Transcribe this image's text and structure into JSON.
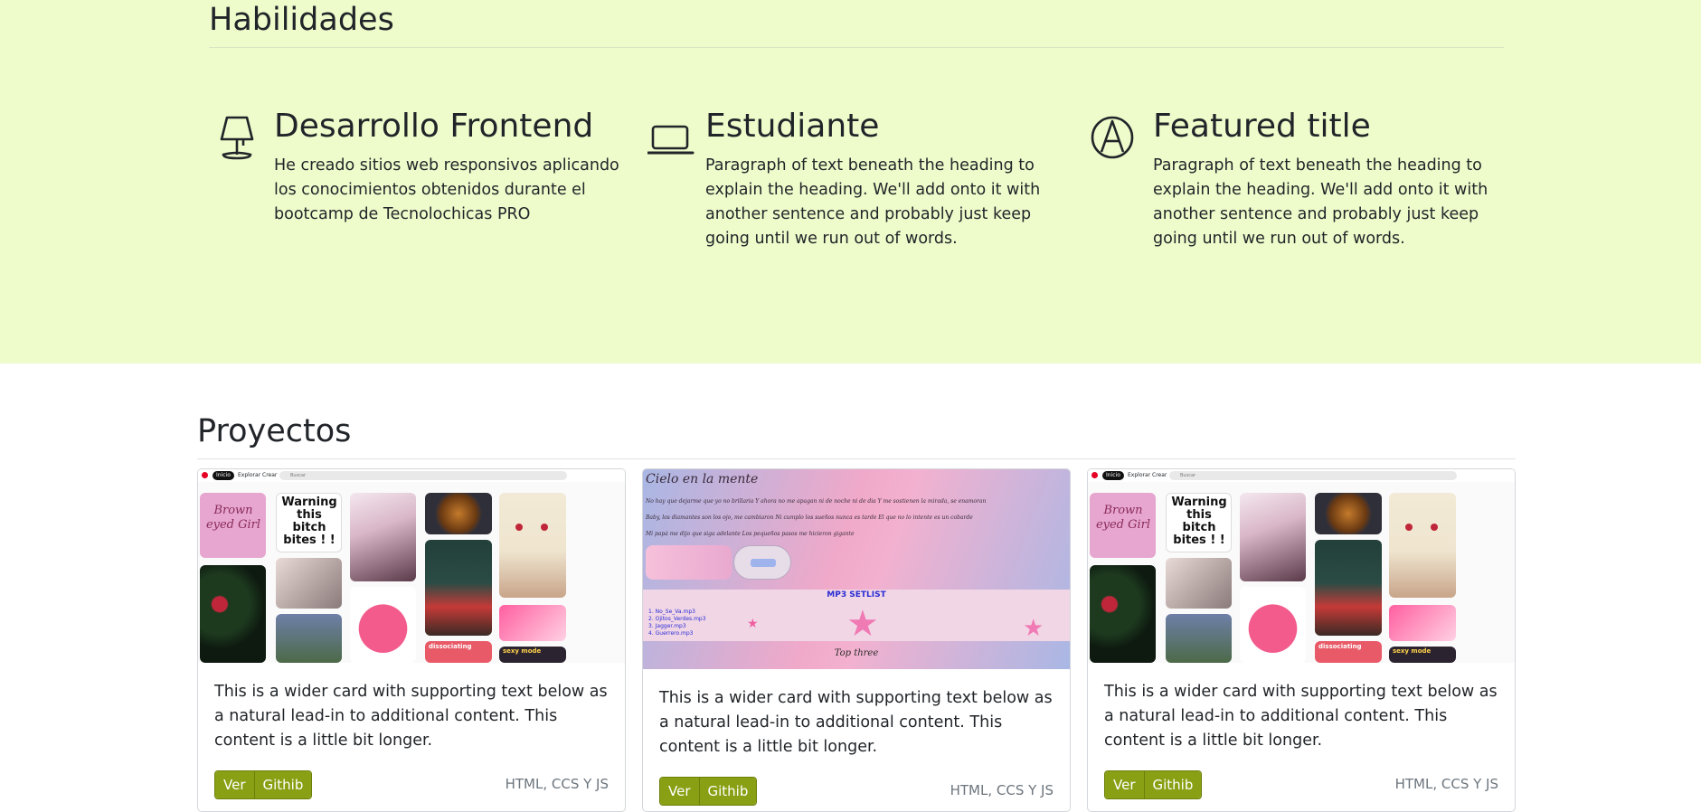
{
  "skills": {
    "title": "Habilidades",
    "features": [
      {
        "icon": "lamp-icon",
        "title": "Desarrollo Frontend",
        "text": "He creado sitios web responsivos aplicando los conocimientos obtenidos durante el bootcamp de Tecnolochicas PRO"
      },
      {
        "icon": "laptop-icon",
        "title": "Estudiante",
        "text": "Paragraph of text beneath the heading to explain the heading. We'll add onto it with another sentence and probably just keep going until we run out of words."
      },
      {
        "icon": "pen-circle-icon",
        "title": "Featured title",
        "text": "Paragraph of text beneath the heading to explain the heading. We'll add onto it with another sentence and probably just keep going until we run out of words."
      }
    ]
  },
  "projects": {
    "title": "Proyectos",
    "cards": [
      {
        "thumb": "pinterest",
        "text": "This is a wider card with supporting text below as a natural lead-in to additional content. This content is a little bit longer.",
        "btn_view": "Ver",
        "btn_github": "Githib",
        "tech": "HTML, CCS Y JS"
      },
      {
        "thumb": "cielo",
        "text": "This is a wider card with supporting text below as a natural lead-in to additional content. This content is a little bit longer.",
        "btn_view": "Ver",
        "btn_github": "Githib",
        "tech": "HTML, CCS Y JS"
      },
      {
        "thumb": "pinterest",
        "text": "This is a wider card with supporting text below as a natural lead-in to additional content. This content is a little bit longer.",
        "btn_view": "Ver",
        "btn_github": "Githib",
        "tech": "HTML, CCS Y JS"
      }
    ]
  },
  "thumb_pinterest": {
    "nav": [
      "Inicio",
      "Explorar",
      "Crear"
    ],
    "search": "Buscar",
    "tile_brown": "Brown eyed Girl",
    "tile_warning": "Warning this bitch bites ! !",
    "tile_dissociating": "dissociating",
    "tile_sexy": "sexy mode"
  },
  "thumb_cielo": {
    "title": "Cielo en la mente",
    "lines": [
      "No hay que dejarme que yo no brillaria Y ahora no me apagan ni de noche ni de dia Y me sostienen la mirada, se enamoran",
      "Baby, los diamantes son los ojo, me cambiaron Ni cumplo los sueños nunca es tarde El que no lo intente es un cobarde",
      "Mi papá me dijo que siga adelante Los pequeños pasos me hicieron gigante"
    ],
    "playlist_title": "MP3 SETLIST",
    "playlist": [
      "1. No_Se_Va.mp3",
      "2. Ojitos_Verdes.mp3",
      "3. Jagger.mp3",
      "4. Guerrero.mp3"
    ],
    "footer": "Top three"
  },
  "colors": {
    "skills_bg": "#eefccb",
    "button_bg": "#8aa014",
    "text": "#212529",
    "muted": "#6c757d"
  }
}
